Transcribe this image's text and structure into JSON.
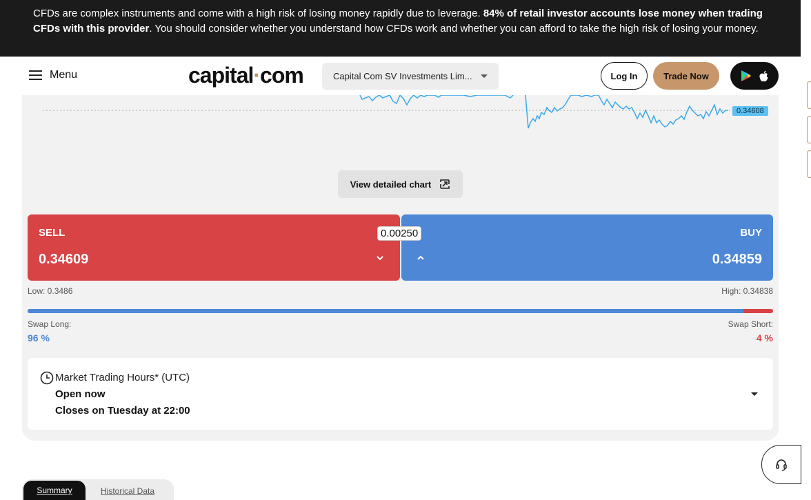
{
  "risk_banner": {
    "text_start": "CFDs are complex instruments and come with a high risk of losing money rapidly due to leverage. ",
    "text_bold": "84% of retail investor accounts lose money when trading CFDs with this provider",
    "text_end": ". You should consider whether you understand how CFDs work and whether you can afford to take the high risk of losing your money."
  },
  "nav": {
    "menu_label": "Menu",
    "logo_left": "capital",
    "logo_dot": "·",
    "logo_right": "com",
    "entity_select": "Capital Com SV Investments Lim...",
    "login_label": "Log In",
    "trade_label": "Trade Now"
  },
  "chart": {
    "current_price_tag": "0.34608",
    "view_detailed_label": "View detailed chart"
  },
  "trade": {
    "sell_label": "SELL",
    "sell_price": "0.34609",
    "buy_label": "BUY",
    "buy_price": "0.34859",
    "spread": "0.00250",
    "low": "Low: 0.3486",
    "high": "High: 0.34838"
  },
  "sentiment": {
    "long_fraction": 0.96,
    "swap_long_label": "Swap Long:",
    "swap_long_value": "96 %",
    "swap_short_label": "Swap Short:",
    "swap_short_value": "4 %",
    "long_color": "#4d87d6",
    "short_color": "#d84345"
  },
  "hours": {
    "title": "Market Trading Hours* (UTC)",
    "status": "Open now",
    "closes": "Closes on Tuesday at 22:00"
  },
  "tabs": {
    "summary": "Summary",
    "historical": "Historical Data"
  },
  "colors": {
    "accent": "#c7966a",
    "sell": "#d84345",
    "buy": "#4d87d6",
    "chart_line": "#3aa8ea"
  }
}
